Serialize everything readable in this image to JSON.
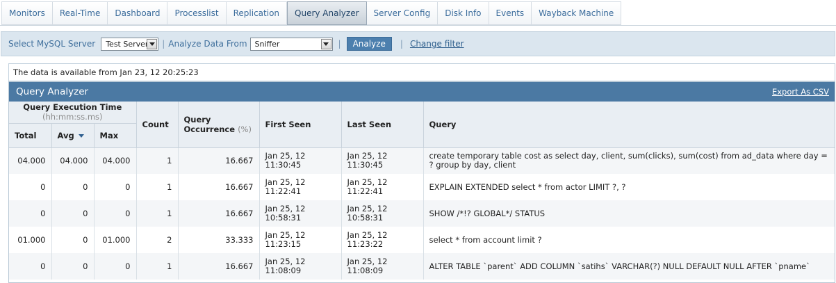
{
  "nav": {
    "tabs": [
      {
        "label": "Monitors"
      },
      {
        "label": "Real-Time"
      },
      {
        "label": "Dashboard"
      },
      {
        "label": "Processlist"
      },
      {
        "label": "Replication"
      },
      {
        "label": "Query Analyzer"
      },
      {
        "label": "Server Config"
      },
      {
        "label": "Disk Info"
      },
      {
        "label": "Events"
      },
      {
        "label": "Wayback Machine"
      }
    ],
    "active": "Query Analyzer"
  },
  "filter": {
    "server_label": "Select MySQL Server",
    "server_value": "Test Server",
    "source_label": "Analyze Data From",
    "source_value": "Sniffer",
    "analyze_button": "Analyze",
    "change_filter": "Change filter"
  },
  "info": {
    "text": "The data is available from Jan 23, 12 20:25:23"
  },
  "panel": {
    "title": "Query Analyzer",
    "export": "Export As CSV"
  },
  "table": {
    "headers": {
      "exec_time": "Query Execution Time",
      "exec_time_unit": "(hh:mm:ss.ms)",
      "total": "Total",
      "avg": "Avg",
      "max": "Max",
      "count": "Count",
      "occurrence": "Query Occurrence",
      "occurrence_unit": "(%)",
      "first_seen": "First Seen",
      "last_seen": "Last Seen",
      "query": "Query"
    },
    "rows": [
      {
        "total": "04.000",
        "avg": "04.000",
        "max": "04.000",
        "count": "1",
        "occurrence": "16.667",
        "first_date": "Jan 25, 12",
        "first_time": "11:30:45",
        "last_date": "Jan 25, 12",
        "last_time": "11:30:45",
        "query": "create temporary table cost as select day, client, sum(clicks), sum(cost) from ad_data where day = ? group by day, client"
      },
      {
        "total": "0",
        "avg": "0",
        "max": "0",
        "count": "1",
        "occurrence": "16.667",
        "first_date": "Jan 25, 12",
        "first_time": "11:22:41",
        "last_date": "Jan 25, 12",
        "last_time": "11:22:41",
        "query": "EXPLAIN EXTENDED select * from actor LIMIT ?, ?"
      },
      {
        "total": "0",
        "avg": "0",
        "max": "0",
        "count": "1",
        "occurrence": "16.667",
        "first_date": "Jan 25, 12",
        "first_time": "10:58:31",
        "last_date": "Jan 25, 12",
        "last_time": "10:58:31",
        "query": "SHOW /*!? GLOBAL*/ STATUS"
      },
      {
        "total": "01.000",
        "avg": "0",
        "max": "01.000",
        "count": "2",
        "occurrence": "33.333",
        "first_date": "Jan 25, 12",
        "first_time": "11:23:15",
        "last_date": "Jan 25, 12",
        "last_time": "11:23:22",
        "query": "select * from account limit ?"
      },
      {
        "total": "0",
        "avg": "0",
        "max": "0",
        "count": "1",
        "occurrence": "16.667",
        "first_date": "Jan 25, 12",
        "first_time": "11:08:09",
        "last_date": "Jan 25, 12",
        "last_time": "11:08:09",
        "query": "ALTER TABLE `parent` ADD COLUMN `satihs` VARCHAR(?) NULL DEFAULT NULL AFTER `pname`"
      }
    ]
  },
  "colors": {
    "panel_header": "#4b79a3",
    "filter_bar": "#dbe6ef",
    "link_text": "#3b6c9c",
    "analyze_button": "#4c7fae"
  }
}
